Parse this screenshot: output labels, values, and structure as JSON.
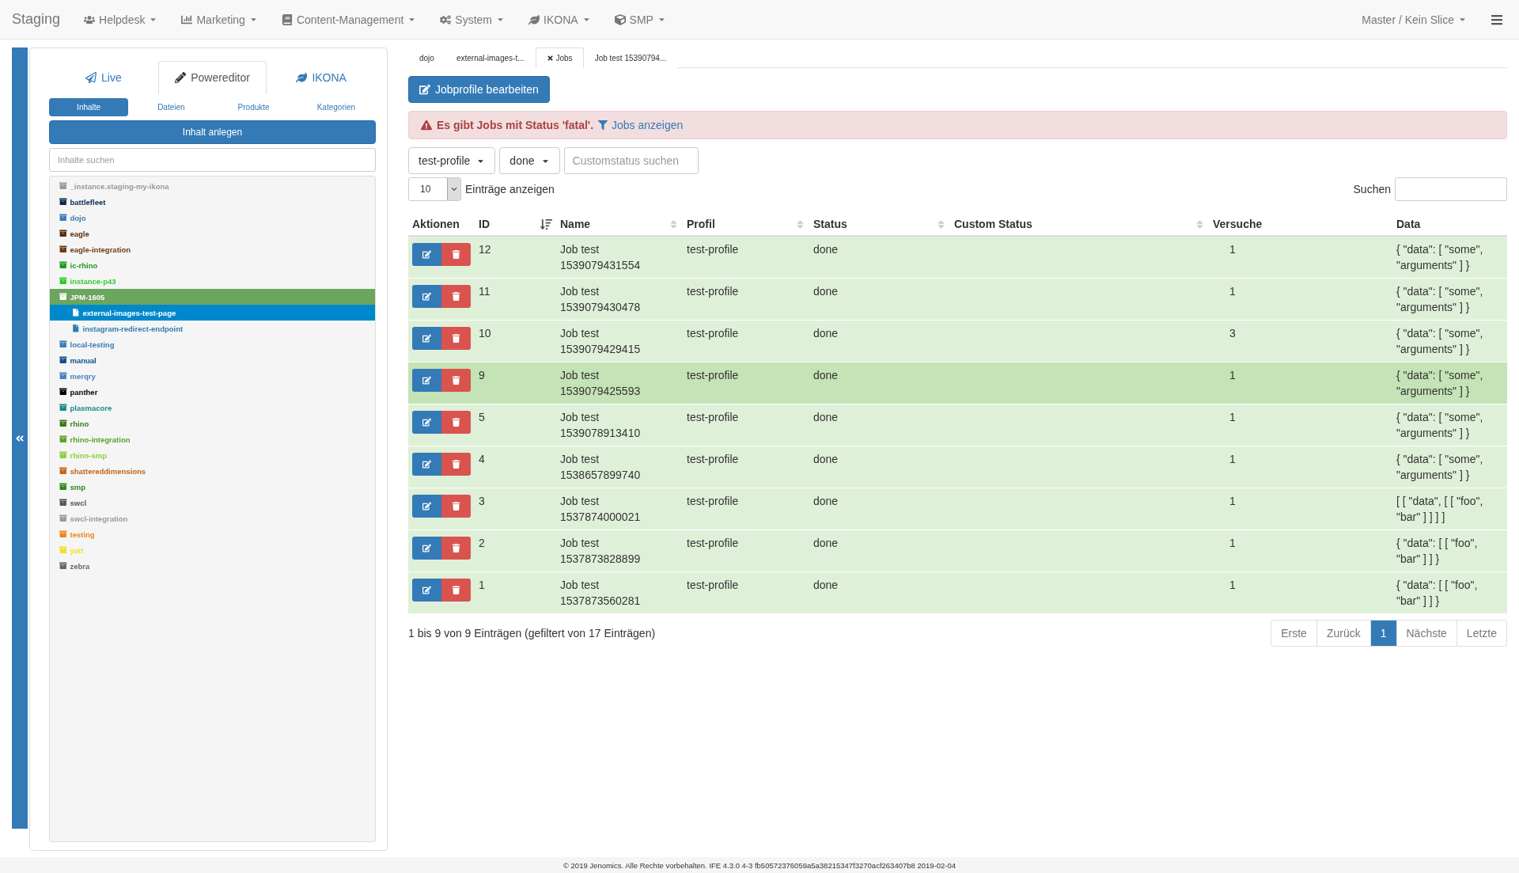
{
  "navbar": {
    "brand": "Staging",
    "menus": [
      {
        "label": "Helpdesk"
      },
      {
        "label": "Marketing"
      },
      {
        "label": "Content-Management"
      },
      {
        "label": "System"
      },
      {
        "label": "IKONA"
      },
      {
        "label": "SMP"
      }
    ],
    "context": "Master / Kein Slice"
  },
  "sidebar": {
    "tabs": [
      {
        "label": "Live",
        "selected": false
      },
      {
        "label": "Powereditor",
        "selected": true
      },
      {
        "label": "IKONA",
        "selected": false
      }
    ],
    "subtabs": [
      {
        "label": "Inhalte",
        "selected": true
      },
      {
        "label": "Dateien",
        "selected": false
      },
      {
        "label": "Produkte",
        "selected": false
      },
      {
        "label": "Kategorien",
        "selected": false
      }
    ],
    "create_button": "Inhalt anlegen",
    "search": {
      "placeholder": "Inhalte suchen"
    },
    "tree": [
      {
        "label": "_instance.staging-my-ikona",
        "color": "#999999",
        "expanded": false,
        "selected": false
      },
      {
        "label": "battlefleet",
        "color": "#0d2a4a",
        "expanded": false,
        "selected": false
      },
      {
        "label": "dojo",
        "color": "#3a7ab8",
        "expanded": false,
        "selected": false
      },
      {
        "label": "eagle",
        "color": "#5a2e0e",
        "expanded": false,
        "selected": false
      },
      {
        "label": "eagle-integration",
        "color": "#6e3a10",
        "expanded": false,
        "selected": false
      },
      {
        "label": "ic-rhino",
        "color": "#1f9a1f",
        "expanded": false,
        "selected": false
      },
      {
        "label": "instance-p43",
        "color": "#2ecc2e",
        "expanded": false,
        "selected": false
      },
      {
        "label": "JPM-1605",
        "color": "#6aa65e",
        "expanded": true,
        "selected": false,
        "children": [
          {
            "label": "external-images-test-page",
            "selected": true
          },
          {
            "label": "instagram-redirect-endpoint",
            "selected": false
          }
        ]
      },
      {
        "label": "local-testing",
        "color": "#3a7ab8",
        "expanded": false,
        "selected": false
      },
      {
        "label": "manual",
        "color": "#134f8c",
        "expanded": false,
        "selected": false
      },
      {
        "label": "merqry",
        "color": "#4a82c0",
        "expanded": false,
        "selected": false
      },
      {
        "label": "panther",
        "color": "#000000",
        "expanded": false,
        "selected": false
      },
      {
        "label": "plasmacore",
        "color": "#1b8a8a",
        "expanded": false,
        "selected": false
      },
      {
        "label": "rhino",
        "color": "#3c7a1a",
        "expanded": false,
        "selected": false
      },
      {
        "label": "rhino-integration",
        "color": "#5aa02a",
        "expanded": false,
        "selected": false
      },
      {
        "label": "rhino-smp",
        "color": "#8cd040",
        "expanded": false,
        "selected": false
      },
      {
        "label": "shattereddimensions",
        "color": "#c0661a",
        "expanded": false,
        "selected": false
      },
      {
        "label": "smp",
        "color": "#2e8a1a",
        "expanded": false,
        "selected": false
      },
      {
        "label": "swcl",
        "color": "#555555",
        "expanded": false,
        "selected": false
      },
      {
        "label": "swcl-integration",
        "color": "#9a9a9a",
        "expanded": false,
        "selected": false
      },
      {
        "label": "testing",
        "color": "#f0841a",
        "expanded": false,
        "selected": false
      },
      {
        "label": "yatt",
        "color": "#f0e020",
        "expanded": false,
        "selected": false
      },
      {
        "label": "zebra",
        "color": "#666666",
        "expanded": false,
        "selected": false
      }
    ]
  },
  "doc_tabs": [
    {
      "label": "dojo",
      "closable": false,
      "selected": false
    },
    {
      "label": "external-images-t...",
      "closable": false,
      "selected": false
    },
    {
      "label": "Jobs",
      "closable": true,
      "selected": true
    },
    {
      "label": "Job test 15390794...",
      "closable": false,
      "selected": false
    }
  ],
  "edit_profiles_button": "Jobprofile bearbeiten",
  "alert": {
    "text": "Es gibt Jobs mit Status 'fatal'.",
    "link": "Jobs anzeigen"
  },
  "filters": {
    "profile": "test-profile",
    "status": "done",
    "custom_status": {
      "placeholder": "Customstatus suchen"
    }
  },
  "length": {
    "value": "10",
    "label": "Einträge anzeigen"
  },
  "search": {
    "label": "Suchen"
  },
  "table": {
    "columns": [
      {
        "label": "Aktionen",
        "sortable": false
      },
      {
        "label": "ID",
        "sortable": true,
        "sorted": true
      },
      {
        "label": "Name",
        "sortable": true,
        "sorted": false
      },
      {
        "label": "Profil",
        "sortable": true,
        "sorted": false
      },
      {
        "label": "Status",
        "sortable": true,
        "sorted": false
      },
      {
        "label": "Custom Status",
        "sortable": true,
        "sorted": false
      },
      {
        "label": "Versuche",
        "sortable": false
      },
      {
        "label": "Data",
        "sortable": false
      }
    ],
    "rows": [
      {
        "id": "12",
        "name": "Job test 1539079431554",
        "profile": "test-profile",
        "status": "done",
        "custom_status": "",
        "attempts": "1",
        "data": "{ \"data\": [ \"some\", \"arguments\" ] }",
        "hovered": false
      },
      {
        "id": "11",
        "name": "Job test 1539079430478",
        "profile": "test-profile",
        "status": "done",
        "custom_status": "",
        "attempts": "1",
        "data": "{ \"data\": [ \"some\", \"arguments\" ] }",
        "hovered": false
      },
      {
        "id": "10",
        "name": "Job test 1539079429415",
        "profile": "test-profile",
        "status": "done",
        "custom_status": "",
        "attempts": "3",
        "data": "{ \"data\": [ \"some\", \"arguments\" ] }",
        "hovered": false
      },
      {
        "id": "9",
        "name": "Job test 1539079425593",
        "profile": "test-profile",
        "status": "done",
        "custom_status": "",
        "attempts": "1",
        "data": "{ \"data\": [ \"some\", \"arguments\" ] }",
        "hovered": true
      },
      {
        "id": "5",
        "name": "Job test 1539078913410",
        "profile": "test-profile",
        "status": "done",
        "custom_status": "",
        "attempts": "1",
        "data": "{ \"data\": [ \"some\", \"arguments\" ] }",
        "hovered": false
      },
      {
        "id": "4",
        "name": "Job test 1538657899740",
        "profile": "test-profile",
        "status": "done",
        "custom_status": "",
        "attempts": "1",
        "data": "{ \"data\": [ \"some\", \"arguments\" ] }",
        "hovered": false
      },
      {
        "id": "3",
        "name": "Job test 1537874000021",
        "profile": "test-profile",
        "status": "done",
        "custom_status": "",
        "attempts": "1",
        "data": "[ [ \"data\", [ [ \"foo\", \"bar\" ] ] ] ]",
        "hovered": false
      },
      {
        "id": "2",
        "name": "Job test 1537873828899",
        "profile": "test-profile",
        "status": "done",
        "custom_status": "",
        "attempts": "1",
        "data": "{ \"data\": [ [ \"foo\", \"bar\" ] ] }",
        "hovered": false
      },
      {
        "id": "1",
        "name": "Job test 1537873560281",
        "profile": "test-profile",
        "status": "done",
        "custom_status": "",
        "attempts": "1",
        "data": "{ \"data\": [ [ \"foo\", \"bar\" ] ] }",
        "hovered": false
      }
    ]
  },
  "info": "1 bis 9 von 9 Einträgen (gefiltert von 17 Einträgen)",
  "pagination": [
    {
      "label": "Erste",
      "selected": false
    },
    {
      "label": "Zurück",
      "selected": false
    },
    {
      "label": "1",
      "selected": true
    },
    {
      "label": "Nächste",
      "selected": false
    },
    {
      "label": "Letzte",
      "selected": false
    }
  ],
  "footer": "© 2019 Jenomics. Alle Rechte vorbehalten. IFE 4.3.0 4-3 fb50572376059a5a38215347f3270acf263407b8 2019-02-04"
}
